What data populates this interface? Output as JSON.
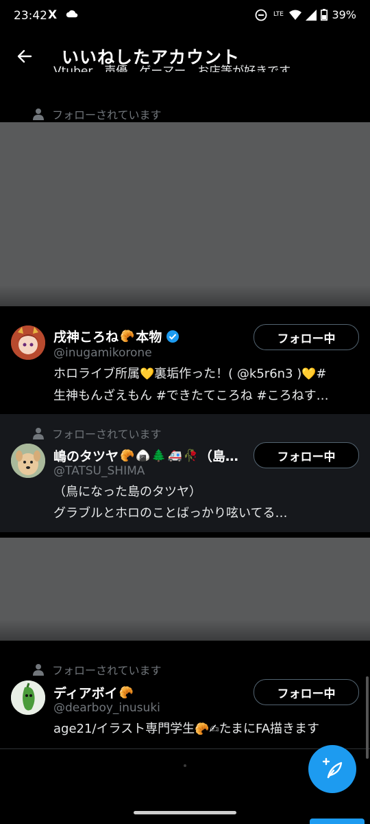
{
  "status_bar": {
    "time": "23:42",
    "x_icon": "X",
    "battery": "39%",
    "lte": "LTE"
  },
  "header": {
    "title": "いいねしたアカウント"
  },
  "partial_bio": "Vtuber、声優、ゲーマー、お店等が好きです…",
  "social_context": "フォローされています",
  "users": [
    {
      "name": "戌神ころね",
      "name_suffix": "本物",
      "handle": "@inugamikorone",
      "bio_line1": "ホロライブ所属",
      "bio_line1b": "裏垢作った！( @k5r6n3 )",
      "bio_line1c": "#",
      "bio_line2": "生神もんざえもん #できたてころね #ころねす…",
      "follow_label": "フォロー中"
    },
    {
      "name": "嶋のタツヤ",
      "name_suffix": "（島…",
      "handle": "@TATSU_SHIMA",
      "bio_line1": "（鳥になった島のタツヤ）",
      "bio_line2": "グラブルとホロのことばっかり呟いてる…",
      "follow_label": "フォロー中"
    },
    {
      "name": "ディアボイ",
      "handle": "@dearboy_inusuki",
      "bio_line1": "age21/イラスト専門学生",
      "bio_line1b": "たまにFA描きます",
      "follow_label": "フォロー中"
    }
  ],
  "colors": {
    "accent": "#1d9bf0",
    "background": "#000000",
    "secondary_text": "#71767b"
  }
}
